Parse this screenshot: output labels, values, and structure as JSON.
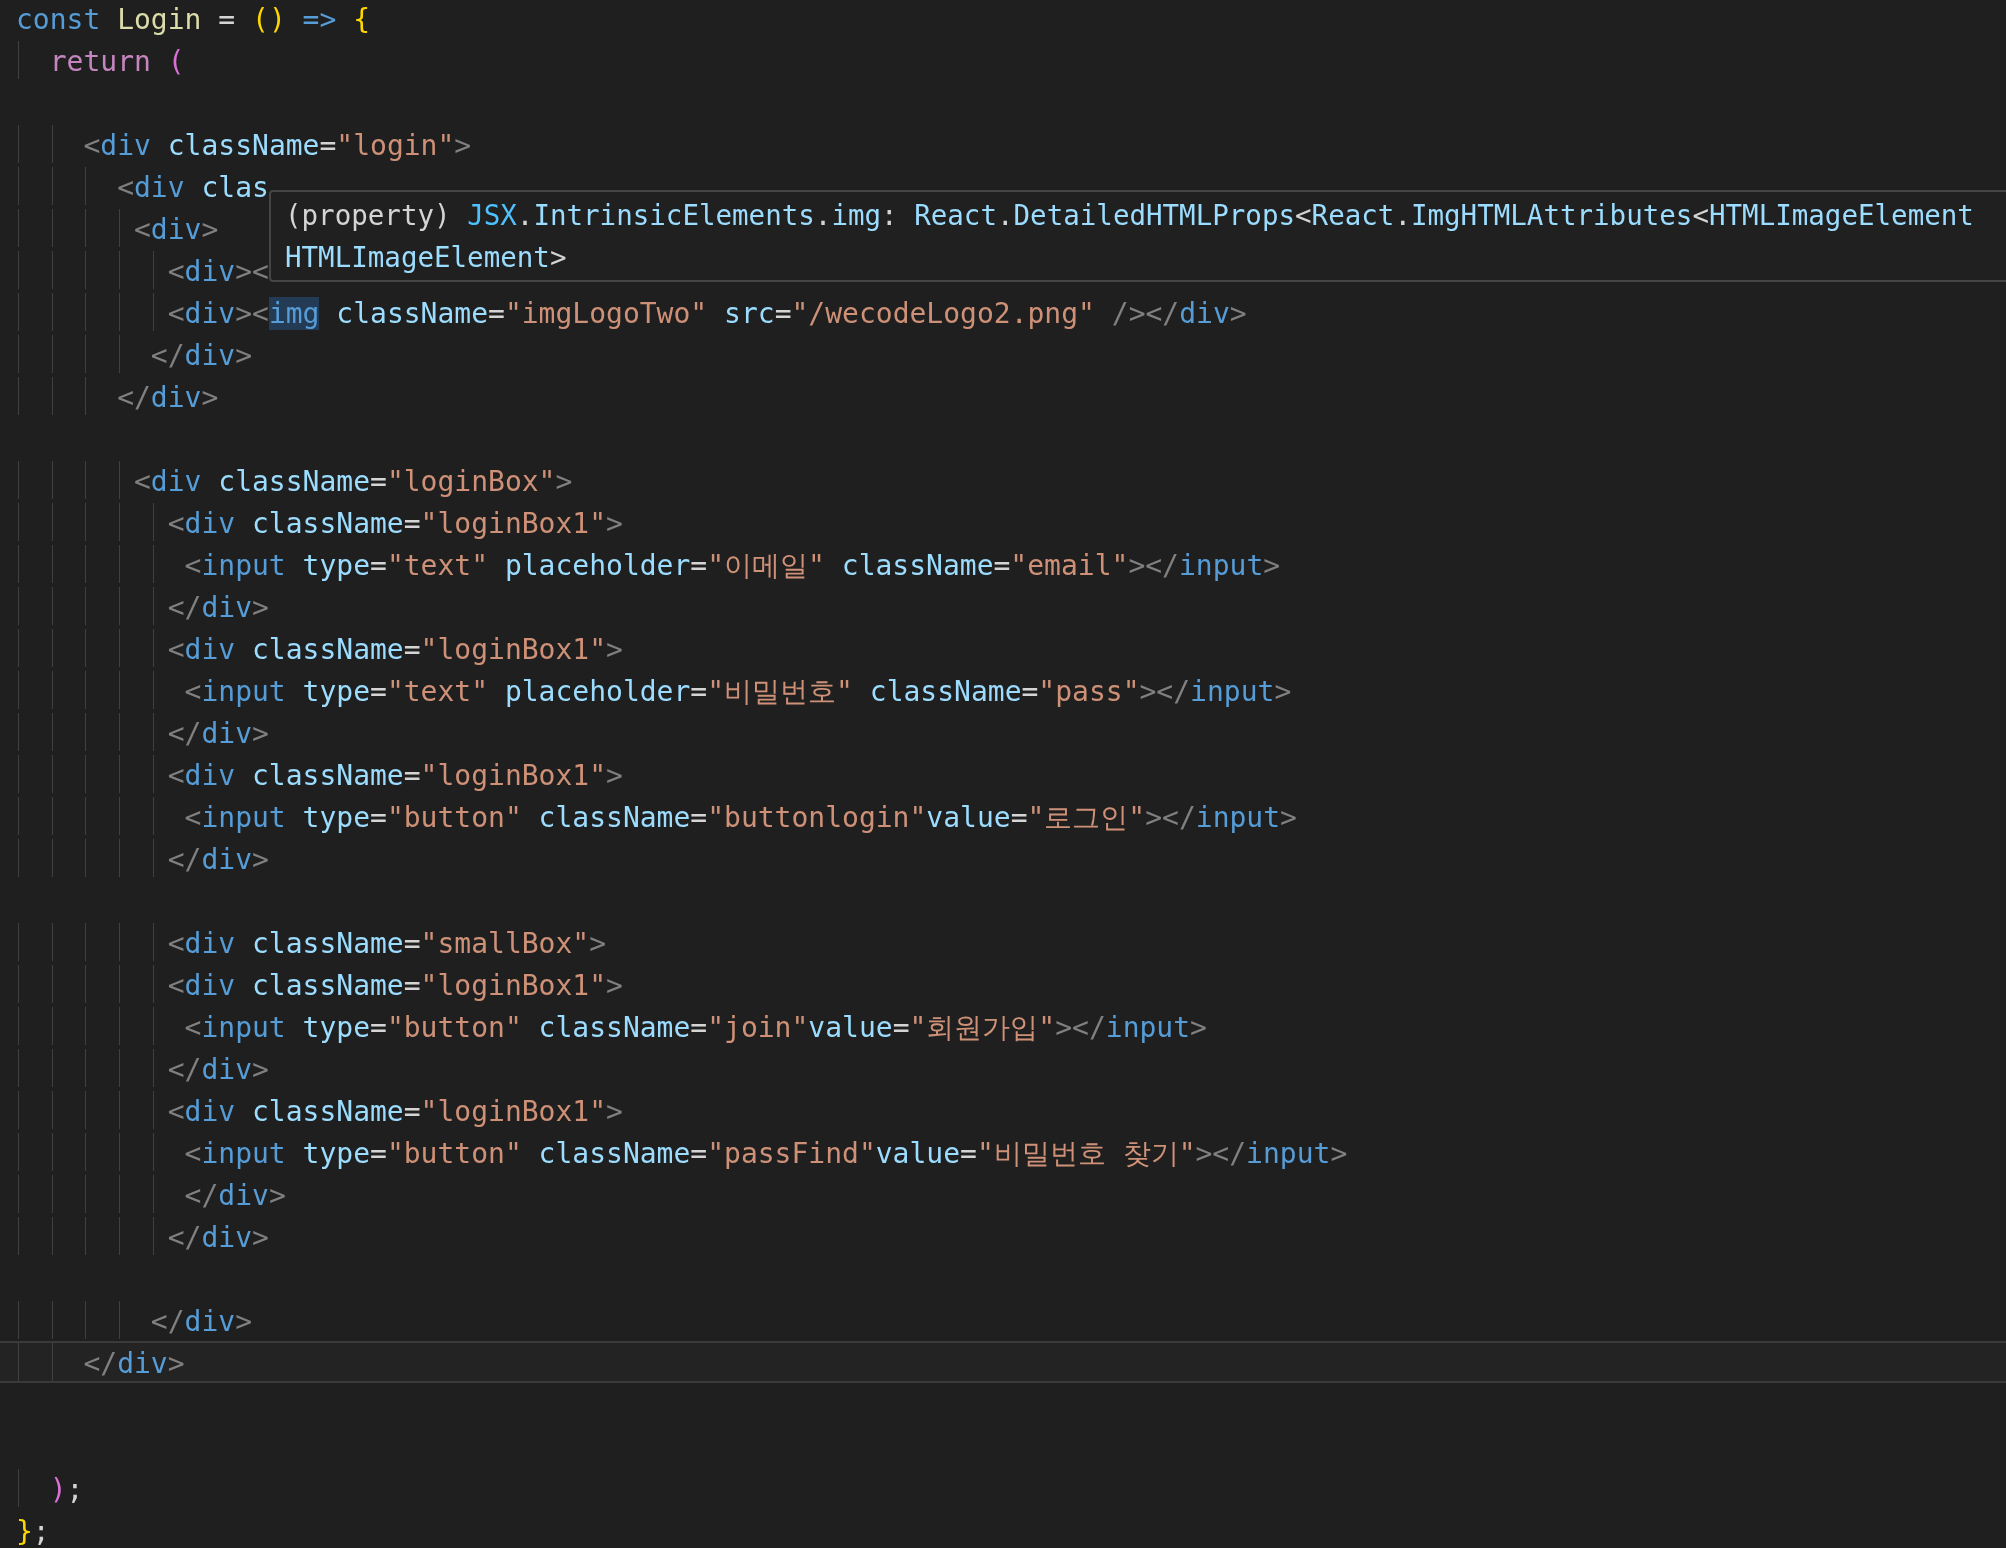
{
  "editor": {
    "lines": [
      {
        "current": false,
        "tokens": [
          {
            "kind": "keyword",
            "text": "const"
          },
          {
            "kind": "function",
            "text": " Login"
          },
          {
            "kind": "plain",
            "text": " ="
          },
          {
            "kind": "bracket",
            "text": " ()"
          },
          {
            "kind": "keyword",
            "text": " =>"
          },
          {
            "kind": "bracket",
            "text": " {"
          }
        ]
      },
      {
        "current": false,
        "tokens": [
          {
            "kind": "control",
            "text": "  return"
          },
          {
            "kind": "bracket2",
            "text": " ("
          }
        ]
      },
      {
        "current": false
      },
      {
        "current": false,
        "tokens": [
          {
            "kind": "punct",
            "text": "    <"
          },
          {
            "kind": "tag",
            "text": "div"
          },
          {
            "kind": "attr",
            "text": " className"
          },
          {
            "kind": "plain",
            "text": "="
          },
          {
            "kind": "string",
            "text": "\"login\""
          },
          {
            "kind": "punct",
            "text": ">"
          }
        ]
      },
      {
        "current": false,
        "tokens": [
          {
            "kind": "punct",
            "text": "      <"
          },
          {
            "kind": "tag",
            "text": "div"
          },
          {
            "kind": "attr",
            "text": " clas"
          }
        ]
      },
      {
        "current": false,
        "tokens": [
          {
            "kind": "punct",
            "text": "       <"
          },
          {
            "kind": "tag",
            "text": "div"
          },
          {
            "kind": "punct",
            "text": ">"
          }
        ]
      },
      {
        "current": false,
        "tokens": [
          {
            "kind": "punct",
            "text": "         <"
          },
          {
            "kind": "tag",
            "text": "div"
          },
          {
            "kind": "punct",
            "text": "><"
          }
        ]
      },
      {
        "current": false,
        "tokens": [
          {
            "kind": "punct",
            "text": "         <"
          },
          {
            "kind": "tag",
            "text": "div"
          },
          {
            "kind": "punct",
            "text": "><"
          },
          {
            "kind": "tag_match",
            "text": "img"
          },
          {
            "kind": "attr",
            "text": " className"
          },
          {
            "kind": "plain",
            "text": "="
          },
          {
            "kind": "string",
            "text": "\"imgLogoTwo\""
          },
          {
            "kind": "attr",
            "text": " src"
          },
          {
            "kind": "plain",
            "text": "="
          },
          {
            "kind": "string",
            "text": "\"/wecodeLogo2.png\""
          },
          {
            "kind": "punct",
            "text": " /></"
          },
          {
            "kind": "tag",
            "text": "div"
          },
          {
            "kind": "punct",
            "text": ">"
          }
        ]
      },
      {
        "current": false,
        "tokens": [
          {
            "kind": "punct",
            "text": "        </"
          },
          {
            "kind": "tag",
            "text": "div"
          },
          {
            "kind": "punct",
            "text": ">"
          }
        ]
      },
      {
        "current": false,
        "tokens": [
          {
            "kind": "punct",
            "text": "      </"
          },
          {
            "kind": "tag",
            "text": "div"
          },
          {
            "kind": "punct",
            "text": ">"
          }
        ]
      },
      {
        "current": false
      },
      {
        "current": false,
        "tokens": [
          {
            "kind": "punct",
            "text": "       <"
          },
          {
            "kind": "tag",
            "text": "div"
          },
          {
            "kind": "attr",
            "text": " className"
          },
          {
            "kind": "plain",
            "text": "="
          },
          {
            "kind": "string",
            "text": "\"loginBox\""
          },
          {
            "kind": "punct",
            "text": ">"
          }
        ]
      },
      {
        "current": false,
        "tokens": [
          {
            "kind": "punct",
            "text": "         <"
          },
          {
            "kind": "tag",
            "text": "div"
          },
          {
            "kind": "attr",
            "text": " className"
          },
          {
            "kind": "plain",
            "text": "="
          },
          {
            "kind": "string",
            "text": "\"loginBox1\""
          },
          {
            "kind": "punct",
            "text": ">"
          }
        ]
      },
      {
        "current": false,
        "tokens": [
          {
            "kind": "punct",
            "text": "          <"
          },
          {
            "kind": "tag",
            "text": "input"
          },
          {
            "kind": "attr",
            "text": " type"
          },
          {
            "kind": "plain",
            "text": "="
          },
          {
            "kind": "string",
            "text": "\"text\""
          },
          {
            "kind": "attr",
            "text": " placeholder"
          },
          {
            "kind": "plain",
            "text": "="
          },
          {
            "kind": "string",
            "text": "\"이메일\""
          },
          {
            "kind": "attr",
            "text": " className"
          },
          {
            "kind": "plain",
            "text": "="
          },
          {
            "kind": "string",
            "text": "\"email\""
          },
          {
            "kind": "punct",
            "text": "></"
          },
          {
            "kind": "tag",
            "text": "input"
          },
          {
            "kind": "punct",
            "text": ">"
          }
        ]
      },
      {
        "current": false,
        "tokens": [
          {
            "kind": "punct",
            "text": "         </"
          },
          {
            "kind": "tag",
            "text": "div"
          },
          {
            "kind": "punct",
            "text": ">"
          }
        ]
      },
      {
        "current": false,
        "tokens": [
          {
            "kind": "punct",
            "text": "         <"
          },
          {
            "kind": "tag",
            "text": "div"
          },
          {
            "kind": "attr",
            "text": " className"
          },
          {
            "kind": "plain",
            "text": "="
          },
          {
            "kind": "string",
            "text": "\"loginBox1\""
          },
          {
            "kind": "punct",
            "text": ">"
          }
        ]
      },
      {
        "current": false,
        "tokens": [
          {
            "kind": "punct",
            "text": "          <"
          },
          {
            "kind": "tag",
            "text": "input"
          },
          {
            "kind": "attr",
            "text": " type"
          },
          {
            "kind": "plain",
            "text": "="
          },
          {
            "kind": "string",
            "text": "\"text\""
          },
          {
            "kind": "attr",
            "text": " placeholder"
          },
          {
            "kind": "plain",
            "text": "="
          },
          {
            "kind": "string",
            "text": "\"비밀번호\""
          },
          {
            "kind": "attr",
            "text": " className"
          },
          {
            "kind": "plain",
            "text": "="
          },
          {
            "kind": "string",
            "text": "\"pass\""
          },
          {
            "kind": "punct",
            "text": "></"
          },
          {
            "kind": "tag",
            "text": "input"
          },
          {
            "kind": "punct",
            "text": ">"
          }
        ]
      },
      {
        "current": false,
        "tokens": [
          {
            "kind": "punct",
            "text": "         </"
          },
          {
            "kind": "tag",
            "text": "div"
          },
          {
            "kind": "punct",
            "text": ">"
          }
        ]
      },
      {
        "current": false,
        "tokens": [
          {
            "kind": "punct",
            "text": "         <"
          },
          {
            "kind": "tag",
            "text": "div"
          },
          {
            "kind": "attr",
            "text": " className"
          },
          {
            "kind": "plain",
            "text": "="
          },
          {
            "kind": "string",
            "text": "\"loginBox1\""
          },
          {
            "kind": "punct",
            "text": ">"
          }
        ]
      },
      {
        "current": false,
        "tokens": [
          {
            "kind": "punct",
            "text": "          <"
          },
          {
            "kind": "tag",
            "text": "input"
          },
          {
            "kind": "attr",
            "text": " type"
          },
          {
            "kind": "plain",
            "text": "="
          },
          {
            "kind": "string",
            "text": "\"button\""
          },
          {
            "kind": "attr",
            "text": " className"
          },
          {
            "kind": "plain",
            "text": "="
          },
          {
            "kind": "string",
            "text": "\"buttonlogin\""
          },
          {
            "kind": "attr",
            "text": "value"
          },
          {
            "kind": "plain",
            "text": "="
          },
          {
            "kind": "string",
            "text": "\"로그인\""
          },
          {
            "kind": "punct",
            "text": "></"
          },
          {
            "kind": "tag",
            "text": "input"
          },
          {
            "kind": "punct",
            "text": ">"
          }
        ]
      },
      {
        "current": false,
        "tokens": [
          {
            "kind": "punct",
            "text": "         </"
          },
          {
            "kind": "tag",
            "text": "div"
          },
          {
            "kind": "punct",
            "text": ">"
          }
        ]
      },
      {
        "current": false
      },
      {
        "current": false,
        "tokens": [
          {
            "kind": "punct",
            "text": "         <"
          },
          {
            "kind": "tag",
            "text": "div"
          },
          {
            "kind": "attr",
            "text": " className"
          },
          {
            "kind": "plain",
            "text": "="
          },
          {
            "kind": "string",
            "text": "\"smallBox\""
          },
          {
            "kind": "punct",
            "text": ">"
          }
        ]
      },
      {
        "current": false,
        "tokens": [
          {
            "kind": "punct",
            "text": "         <"
          },
          {
            "kind": "tag",
            "text": "div"
          },
          {
            "kind": "attr",
            "text": " className"
          },
          {
            "kind": "plain",
            "text": "="
          },
          {
            "kind": "string",
            "text": "\"loginBox1\""
          },
          {
            "kind": "punct",
            "text": ">"
          }
        ]
      },
      {
        "current": false,
        "tokens": [
          {
            "kind": "punct",
            "text": "          <"
          },
          {
            "kind": "tag",
            "text": "input"
          },
          {
            "kind": "attr",
            "text": " type"
          },
          {
            "kind": "plain",
            "text": "="
          },
          {
            "kind": "string",
            "text": "\"button\""
          },
          {
            "kind": "attr",
            "text": " className"
          },
          {
            "kind": "plain",
            "text": "="
          },
          {
            "kind": "string",
            "text": "\"join\""
          },
          {
            "kind": "attr",
            "text": "value"
          },
          {
            "kind": "plain",
            "text": "="
          },
          {
            "kind": "string",
            "text": "\"회원가입\""
          },
          {
            "kind": "punct",
            "text": "></"
          },
          {
            "kind": "tag",
            "text": "input"
          },
          {
            "kind": "punct",
            "text": ">"
          }
        ]
      },
      {
        "current": false,
        "tokens": [
          {
            "kind": "punct",
            "text": "         </"
          },
          {
            "kind": "tag",
            "text": "div"
          },
          {
            "kind": "punct",
            "text": ">"
          }
        ]
      },
      {
        "current": false,
        "tokens": [
          {
            "kind": "punct",
            "text": "         <"
          },
          {
            "kind": "tag",
            "text": "div"
          },
          {
            "kind": "attr",
            "text": " className"
          },
          {
            "kind": "plain",
            "text": "="
          },
          {
            "kind": "string",
            "text": "\"loginBox1\""
          },
          {
            "kind": "punct",
            "text": ">"
          }
        ]
      },
      {
        "current": false,
        "tokens": [
          {
            "kind": "punct",
            "text": "          <"
          },
          {
            "kind": "tag",
            "text": "input"
          },
          {
            "kind": "attr",
            "text": " type"
          },
          {
            "kind": "plain",
            "text": "="
          },
          {
            "kind": "string",
            "text": "\"button\""
          },
          {
            "kind": "attr",
            "text": " className"
          },
          {
            "kind": "plain",
            "text": "="
          },
          {
            "kind": "string",
            "text": "\"passFind\""
          },
          {
            "kind": "attr",
            "text": "value"
          },
          {
            "kind": "plain",
            "text": "="
          },
          {
            "kind": "string",
            "text": "\"비밀번호 찾기\""
          },
          {
            "kind": "punct",
            "text": "></"
          },
          {
            "kind": "tag",
            "text": "input"
          },
          {
            "kind": "punct",
            "text": ">"
          }
        ]
      },
      {
        "current": false,
        "tokens": [
          {
            "kind": "punct",
            "text": "          </"
          },
          {
            "kind": "tag",
            "text": "div"
          },
          {
            "kind": "punct",
            "text": ">"
          }
        ]
      },
      {
        "current": false,
        "tokens": [
          {
            "kind": "punct",
            "text": "         </"
          },
          {
            "kind": "tag",
            "text": "div"
          },
          {
            "kind": "punct",
            "text": ">"
          }
        ]
      },
      {
        "current": false
      },
      {
        "current": false,
        "tokens": [
          {
            "kind": "punct",
            "text": "        </"
          },
          {
            "kind": "tag",
            "text": "div"
          },
          {
            "kind": "punct",
            "text": ">"
          }
        ]
      },
      {
        "current": true,
        "tokens": [
          {
            "kind": "punct",
            "text": "    </"
          },
          {
            "kind": "tag",
            "text": "div"
          },
          {
            "kind": "punct",
            "text": ">"
          }
        ]
      },
      {
        "current": false
      },
      {
        "current": false
      },
      {
        "current": false,
        "tokens": [
          {
            "kind": "bracket2",
            "text": "  )"
          },
          {
            "kind": "plain",
            "text": ";"
          }
        ]
      },
      {
        "current": false,
        "tokens": [
          {
            "kind": "bracket",
            "text": "}"
          },
          {
            "kind": "plain",
            "text": ";"
          }
        ]
      }
    ]
  },
  "tooltip": {
    "lines": [
      [
        {
          "kind": "plain",
          "text": "(property)"
        },
        {
          "kind": "namespace",
          "text": " JSX"
        },
        {
          "kind": "plain",
          "text": "."
        },
        {
          "kind": "attr",
          "text": "IntrinsicElements"
        },
        {
          "kind": "plain",
          "text": "."
        },
        {
          "kind": "attr",
          "text": "img"
        },
        {
          "kind": "plain",
          "text": ":"
        },
        {
          "kind": "attr",
          "text": " React"
        },
        {
          "kind": "plain",
          "text": "."
        },
        {
          "kind": "attr",
          "text": "DetailedHTMLProps"
        },
        {
          "kind": "plain",
          "text": "<"
        },
        {
          "kind": "attr",
          "text": "React"
        },
        {
          "kind": "plain",
          "text": "."
        },
        {
          "kind": "attr",
          "text": "ImgHTMLAttributes"
        },
        {
          "kind": "plain",
          "text": "<"
        },
        {
          "kind": "attr",
          "text": "HTMLImageElement"
        }
      ],
      [
        {
          "kind": "attr",
          "text": "HTMLImageElement"
        },
        {
          "kind": "plain",
          "text": ">"
        }
      ]
    ]
  }
}
